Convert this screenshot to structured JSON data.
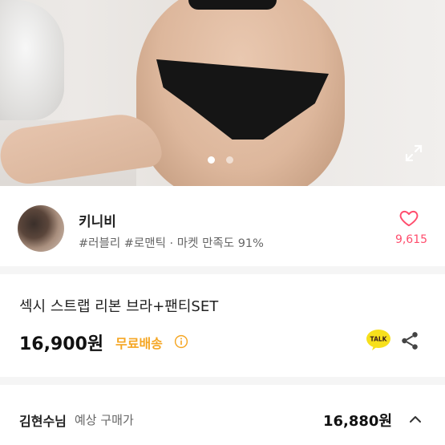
{
  "gallery": {
    "slide_count": 2,
    "active_index": 0,
    "expand_icon": "expand-icon"
  },
  "seller": {
    "name": "키니비",
    "tags": "#러블리 #로맨틱 · 마켓 만족도 91%",
    "likes": "9,615",
    "heart_icon": "heart-icon"
  },
  "product": {
    "title": "섹시 스트랩 리본 브라+팬티SET",
    "price": "16,900원",
    "shipping": "무료배송",
    "talk_label": "TALK"
  },
  "buyer": {
    "name": "김현수님",
    "label": "예상 구매가",
    "price": "16,880원"
  },
  "colors": {
    "accent_pink": "#ff4d6d",
    "shipping_orange": "#f5a623",
    "kakao_yellow": "#f7e01c"
  }
}
